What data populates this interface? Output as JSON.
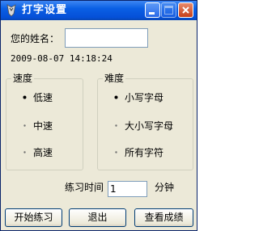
{
  "window": {
    "title": "打字设置",
    "controls": [
      "minimize",
      "maximize",
      "close"
    ]
  },
  "form": {
    "name_label": "您的姓名：",
    "name_value": "",
    "datetime": "2009-08-07 14:18:24"
  },
  "speed_group": {
    "title": "速度",
    "options": [
      {
        "label": "低速",
        "selected": true
      },
      {
        "label": "中速",
        "selected": false
      },
      {
        "label": "高速",
        "selected": false
      }
    ]
  },
  "difficulty_group": {
    "title": "难度",
    "options": [
      {
        "label": "小写字母",
        "selected": true
      },
      {
        "label": "大小写字母",
        "selected": false
      },
      {
        "label": "所有字符",
        "selected": false
      }
    ]
  },
  "practice": {
    "label": "练习时间",
    "value": "1",
    "unit": "分钟"
  },
  "buttons": {
    "start": "开始练习",
    "exit": "退出",
    "view_scores": "查看成绩"
  },
  "colors": {
    "titlebar": "#0a5fe4",
    "window_bg": "#ece9d8",
    "close_button": "#c6401a"
  }
}
